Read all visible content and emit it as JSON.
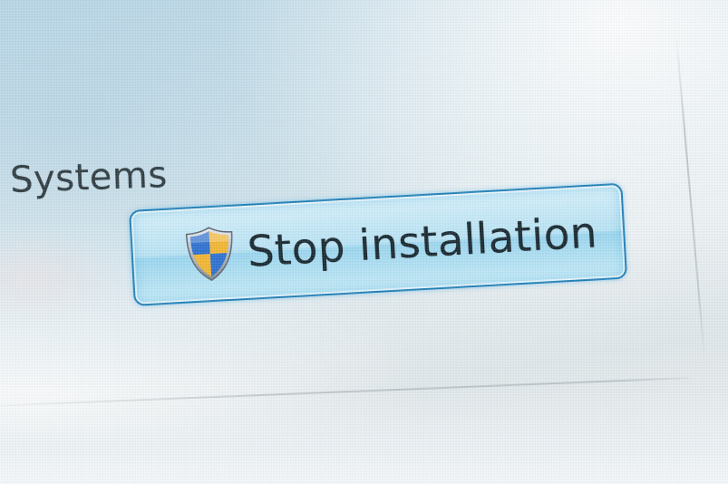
{
  "section": {
    "label": "Systems"
  },
  "button": {
    "label": "Stop installation",
    "icon": "uac-shield-icon"
  },
  "colors": {
    "button_border": "#1d7fb8",
    "button_fill": "#b8e3f5",
    "shield_blue": "#2a6fd0",
    "shield_yellow": "#f2b531"
  }
}
